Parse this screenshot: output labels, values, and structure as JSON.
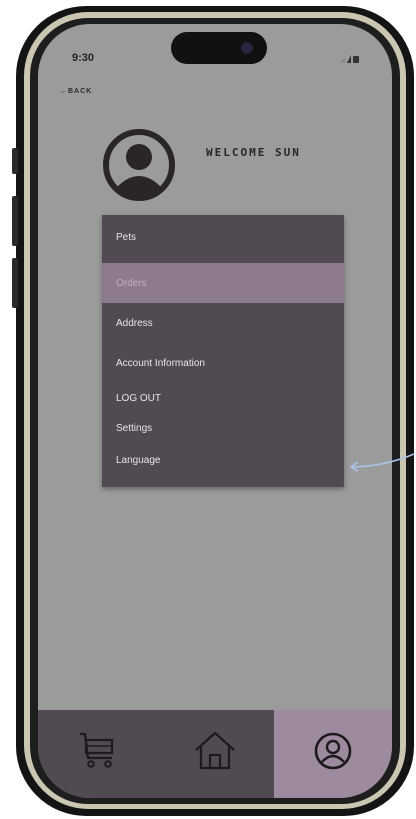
{
  "status_bar": {
    "time": "9:30"
  },
  "back_label": "←BACK",
  "welcome_text": "WELCOME SUN",
  "menu": {
    "items": [
      {
        "label": "Pets",
        "selected": false
      },
      {
        "label": "Orders",
        "selected": true
      },
      {
        "label": "Address",
        "selected": false
      },
      {
        "label": "Account Information",
        "selected": false
      },
      {
        "label": "LOG OUT",
        "selected": false
      },
      {
        "label": "Settings",
        "selected": false
      },
      {
        "label": "Language",
        "selected": false
      }
    ]
  },
  "bottom_nav": {
    "items": [
      {
        "icon": "cart-icon",
        "active": false
      },
      {
        "icon": "home-icon",
        "active": false
      },
      {
        "icon": "profile-icon",
        "active": true
      }
    ]
  },
  "colors": {
    "screen_bg": "#9c9b9b",
    "menu_bg": "#524a52",
    "menu_selected": "#8e7a8e",
    "nav_active": "#9e8a9e",
    "annotation": "#a9c4ea"
  }
}
